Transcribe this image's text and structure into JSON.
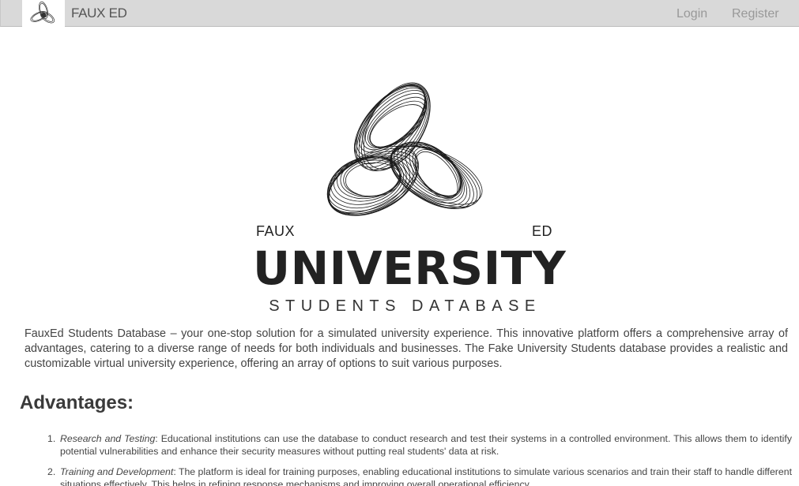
{
  "navbar": {
    "brand": "FAUX ED",
    "login": "Login",
    "register": "Register"
  },
  "hero": {
    "logo_left": "FAUX",
    "logo_right": "ED",
    "title": "UNIVERSITY",
    "subtitle": "STUDENTS DATABASE"
  },
  "intro": "FauxEd Students Database – your one-stop solution for a simulated university experience. This innovative platform offers a comprehensive array of advantages, catering to a diverse range of needs for both individuals and businesses. The Fake University Students database provides a realistic and customizable virtual university experience, offering an array of options to suit various purposes.",
  "advantages": {
    "heading": "Advantages:",
    "items": [
      {
        "number": "1.",
        "name": "Research and Testing",
        "text": ": Educational institutions can use the database to conduct research and test their systems in a controlled environment. This allows them to identify potential vulnerabilities and enhance their security measures without putting real students' data at risk."
      },
      {
        "number": "2.",
        "name": "Training and Development",
        "text": ": The platform is ideal for training purposes, enabling educational institutions to simulate various scenarios and train their staff to handle different situations effectively. This helps in refining response mechanisms and improving overall operational efficiency."
      }
    ]
  },
  "colors": {
    "navbar_bg": "#d9d9d9",
    "nav_link": "#999999",
    "logo_ink": "#222222"
  },
  "icons": {
    "nav_logo": "knot-logo-icon",
    "hero_logo": "triple-ellipse-knot-icon"
  }
}
